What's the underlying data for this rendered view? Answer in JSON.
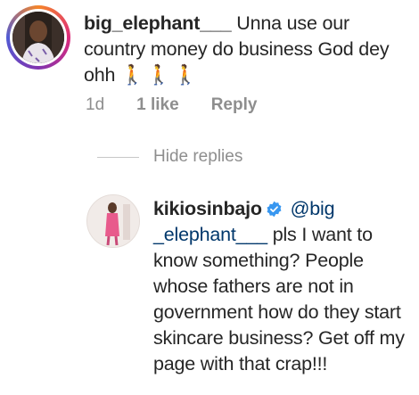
{
  "comment": {
    "username": "big_elephant___",
    "text": "Unna use our country money do business God dey ohh",
    "emoji": "🚶🚶🚶",
    "time": "1d",
    "likes": "1 like",
    "reply_label": "Reply"
  },
  "replies": {
    "hide_label": "Hide replies"
  },
  "reply": {
    "username": "kikiosinbajo",
    "mention_part1": "@big",
    "mention_part2": "_elephant___",
    "text": "pls I want to know something? People whose fathers are not in government  how do they start skincare business? Get off my page with that crap!!!"
  },
  "colors": {
    "muted": "#8e8e8e",
    "mention": "#00376b",
    "verified": "#3897f0"
  }
}
